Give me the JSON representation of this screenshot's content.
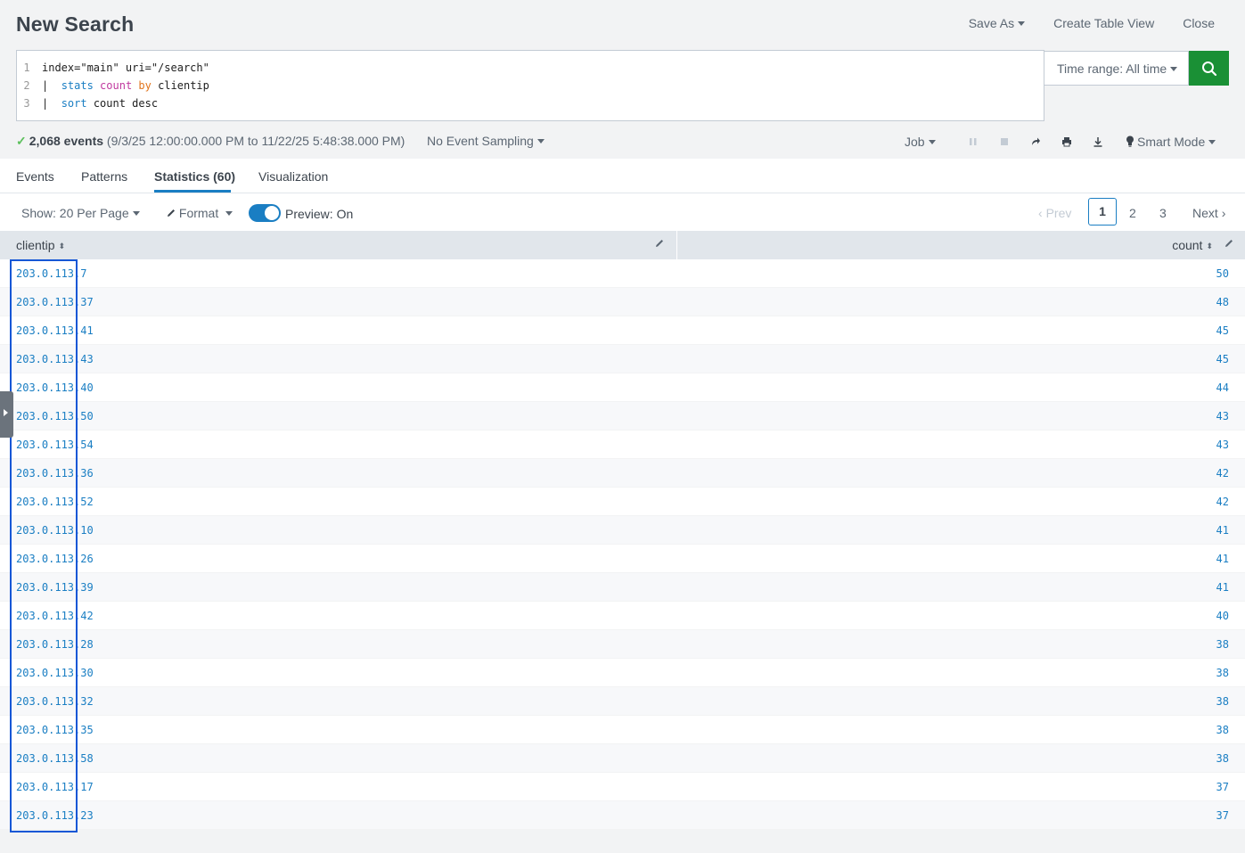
{
  "header": {
    "title": "New Search",
    "save_as": "Save As",
    "create_table_view": "Create Table View",
    "close": "Close"
  },
  "search": {
    "lines": [
      {
        "num": "1",
        "parts": [
          {
            "t": "index=\"main\" uri=\"/search\"",
            "c": "txt"
          }
        ]
      },
      {
        "num": "2",
        "parts": [
          {
            "t": "|  ",
            "c": "txt"
          },
          {
            "t": "stats",
            "c": "kw"
          },
          {
            "t": " ",
            "c": "txt"
          },
          {
            "t": "count",
            "c": "fn"
          },
          {
            "t": " ",
            "c": "txt"
          },
          {
            "t": "by",
            "c": "by"
          },
          {
            "t": " clientip",
            "c": "txt"
          }
        ]
      },
      {
        "num": "3",
        "parts": [
          {
            "t": "|  ",
            "c": "txt"
          },
          {
            "t": "sort",
            "c": "kw"
          },
          {
            "t": " count desc",
            "c": "txt"
          }
        ]
      }
    ],
    "time_range": "Time range: All time"
  },
  "status": {
    "events_count": "2,068 events",
    "range": " (9/3/25 12:00:00.000 PM to 11/22/25 5:48:38.000 PM)",
    "sampling": "No Event Sampling",
    "job": "Job",
    "smart_mode": "Smart Mode"
  },
  "tabs": {
    "events": "Events",
    "patterns": "Patterns",
    "statistics": "Statistics (60)",
    "visualization": "Visualization"
  },
  "toolbar": {
    "show": "Show: 20 Per Page",
    "format": "Format",
    "preview": "Preview: On",
    "prev": "Prev",
    "page_current": "1",
    "page_2": "2",
    "page_3": "3",
    "next": "Next"
  },
  "table": {
    "col_clientip": "clientip",
    "col_count": "count",
    "rows": [
      {
        "ip": "203.0.113.7",
        "count": "50"
      },
      {
        "ip": "203.0.113.37",
        "count": "48"
      },
      {
        "ip": "203.0.113.41",
        "count": "45"
      },
      {
        "ip": "203.0.113.43",
        "count": "45"
      },
      {
        "ip": "203.0.113.40",
        "count": "44"
      },
      {
        "ip": "203.0.113.50",
        "count": "43"
      },
      {
        "ip": "203.0.113.54",
        "count": "43"
      },
      {
        "ip": "203.0.113.36",
        "count": "42"
      },
      {
        "ip": "203.0.113.52",
        "count": "42"
      },
      {
        "ip": "203.0.113.10",
        "count": "41"
      },
      {
        "ip": "203.0.113.26",
        "count": "41"
      },
      {
        "ip": "203.0.113.39",
        "count": "41"
      },
      {
        "ip": "203.0.113.42",
        "count": "40"
      },
      {
        "ip": "203.0.113.28",
        "count": "38"
      },
      {
        "ip": "203.0.113.30",
        "count": "38"
      },
      {
        "ip": "203.0.113.32",
        "count": "38"
      },
      {
        "ip": "203.0.113.35",
        "count": "38"
      },
      {
        "ip": "203.0.113.58",
        "count": "38"
      },
      {
        "ip": "203.0.113.17",
        "count": "37"
      },
      {
        "ip": "203.0.113.23",
        "count": "37"
      }
    ]
  },
  "colors": {
    "accent": "#1a7ec3",
    "search_button": "#1a9035",
    "highlight": "#1657d6"
  }
}
